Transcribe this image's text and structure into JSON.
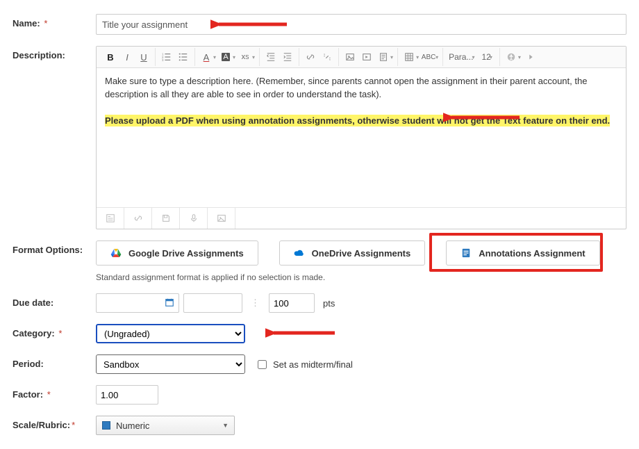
{
  "name": {
    "label": "Name:",
    "required": "*",
    "value": "Title your assignment"
  },
  "description": {
    "label": "Description:",
    "body_line1": "Make sure to type a description here. (Remember, since parents cannot open the assignment in their parent account, the description is all they are able to see in order to understand the task).",
    "body_highlight": "Please upload a PDF when using annotation assignments, otherwise student will not get the Text feature on their end.",
    "toolbar": {
      "para_label": "Para...",
      "size_label": "12"
    }
  },
  "format": {
    "label": "Format Options:",
    "google": "Google Drive Assignments",
    "onedrive": "OneDrive Assignments",
    "annotations": "Annotations Assignment",
    "note": "Standard assignment format is applied if no selection is made."
  },
  "due": {
    "label": "Due date:",
    "points_value": "100",
    "points_label": "pts"
  },
  "category": {
    "label": "Category:",
    "required": "*",
    "value": "(Ungraded)"
  },
  "period": {
    "label": "Period:",
    "value": "Sandbox",
    "checkbox_label": "Set as midterm/final"
  },
  "factor": {
    "label": "Factor:",
    "required": "*",
    "value": "1.00"
  },
  "scale": {
    "label": "Scale/Rubric:",
    "required": "*",
    "value": "Numeric"
  }
}
